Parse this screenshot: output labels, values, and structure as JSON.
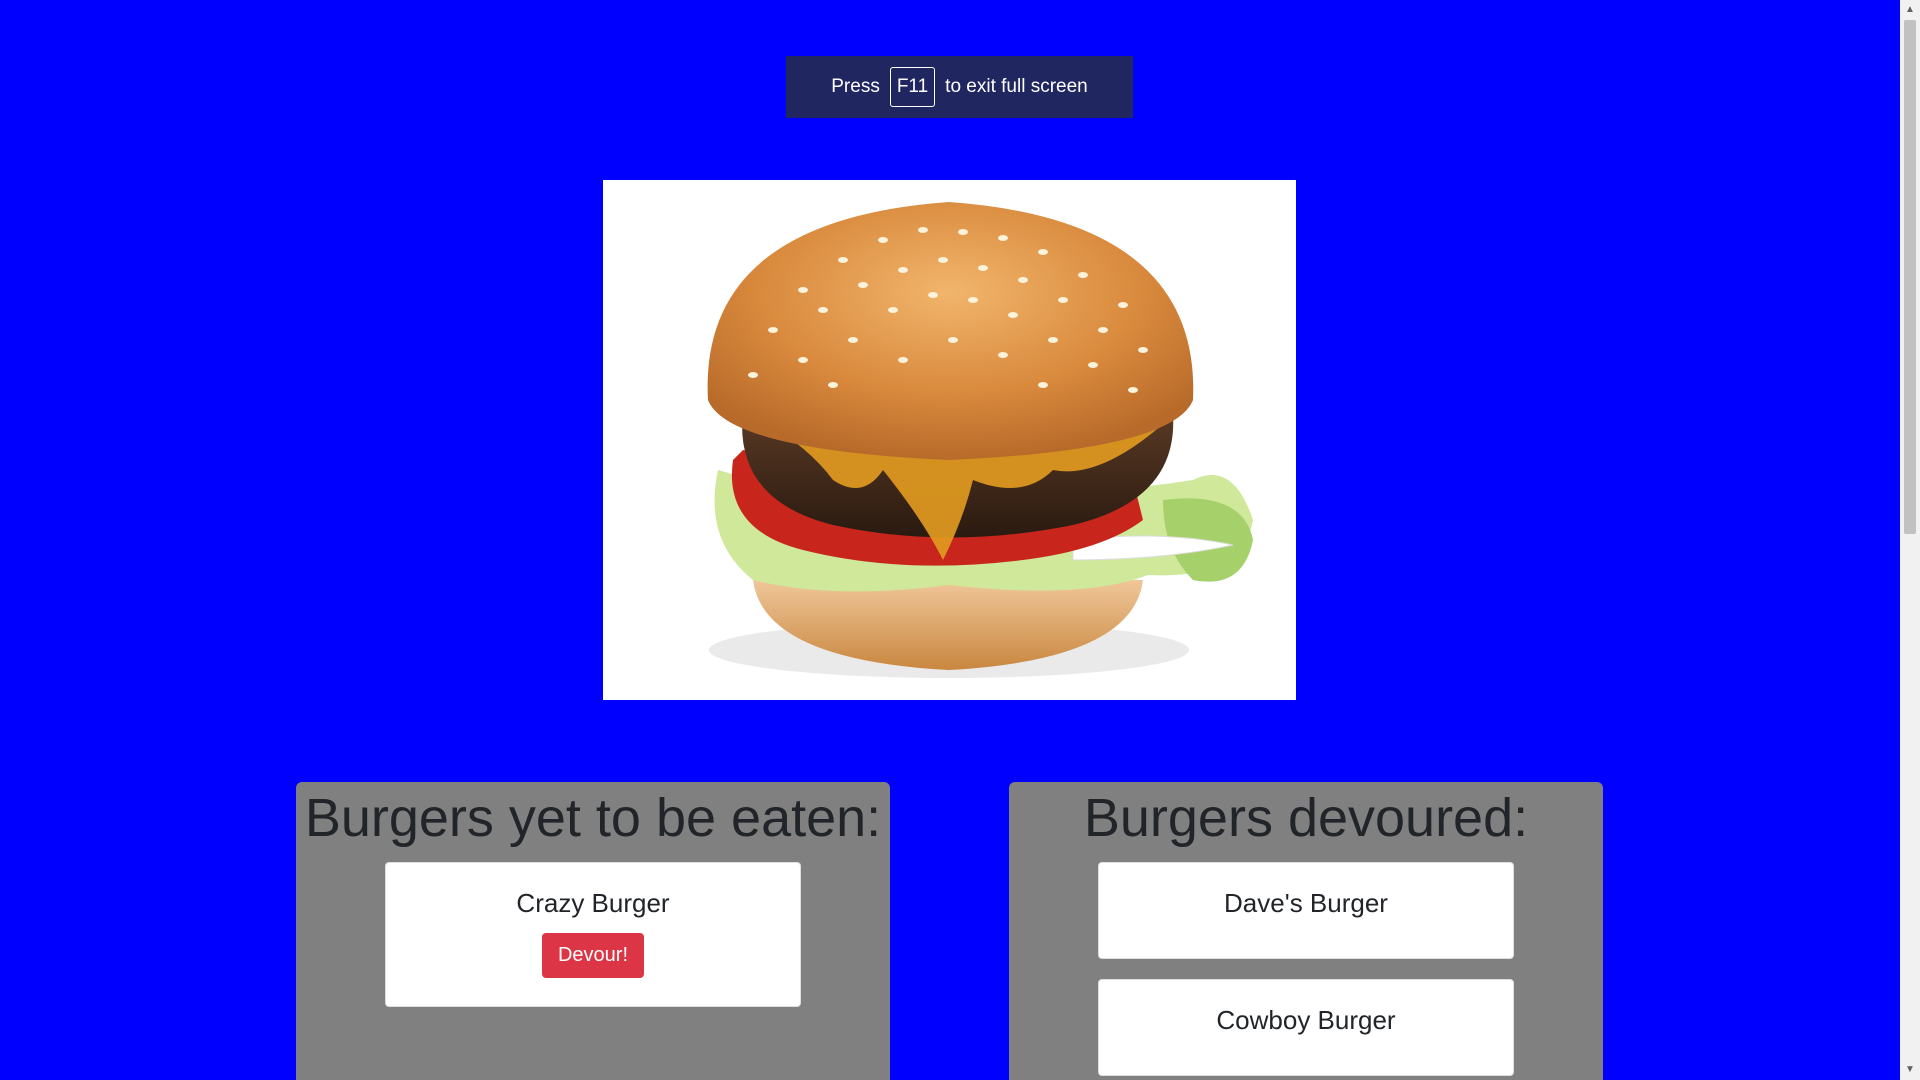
{
  "fullscreen_notice": {
    "before": "Press",
    "key": "F11",
    "after": "to exit full screen"
  },
  "hero": {
    "image_alt": "Cheeseburger with sesame bun"
  },
  "uneaten": {
    "heading": "Burgers yet to be eaten:",
    "burgers": [
      {
        "name": "Crazy Burger",
        "button_label": "Devour!"
      }
    ]
  },
  "devoured": {
    "heading": "Burgers devoured:",
    "burgers": [
      {
        "name": "Dave's Burger"
      },
      {
        "name": "Cowboy Burger"
      }
    ]
  },
  "colors": {
    "page_background": "#0000ff",
    "panel_background": "#808080",
    "devour_button": "#dc3545"
  },
  "icons": {
    "scroll_up": "caret-up-icon",
    "scroll_down": "caret-down-icon"
  }
}
